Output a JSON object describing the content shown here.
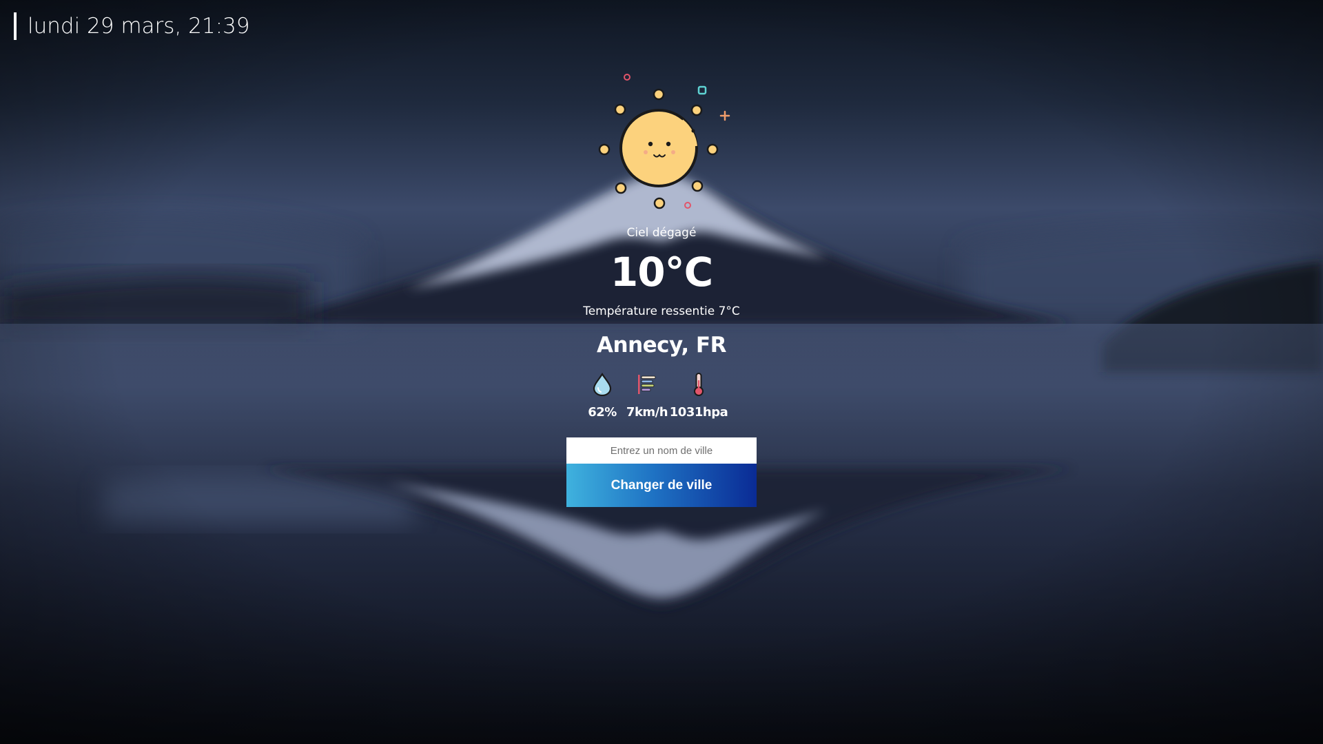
{
  "header": {
    "datetime": "lundi 29 mars, 21:39"
  },
  "weather": {
    "icon": "sun-icon",
    "description": "Ciel dégagé",
    "temperature": "10°C",
    "feels_like": "Température ressentie 7°C",
    "city": "Annecy, FR"
  },
  "stats": {
    "humidity": {
      "icon": "water-drop-icon",
      "value": "62%"
    },
    "wind": {
      "icon": "wind-icon",
      "value": "7km/h"
    },
    "pressure": {
      "icon": "thermometer-icon",
      "value": "1031hpa"
    }
  },
  "search": {
    "placeholder": "Entrez un nom de ville",
    "value": "",
    "button_label": "Changer de ville"
  },
  "colors": {
    "sun": "#fcd27d",
    "button_start": "#3fb2de",
    "button_end": "#0a2b95"
  }
}
